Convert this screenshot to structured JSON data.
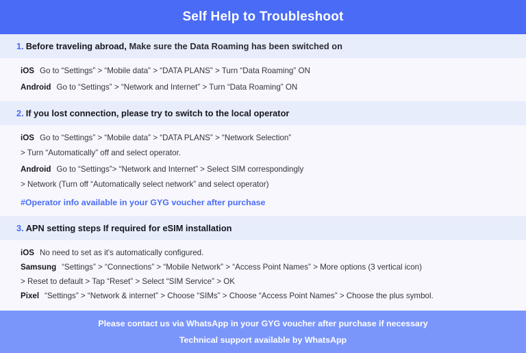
{
  "header": {
    "title": "Self Help to Troubleshoot",
    "bg_color": "#4a6bf5",
    "text_color": "#ffffff"
  },
  "theme": {
    "page_bg": "#f5f5fd",
    "band_bg": "#e7edfb",
    "accent": "#4a6bf5",
    "footer_bg": "#7b96fb",
    "body_text": "#34343e"
  },
  "sections": [
    {
      "number": "1.",
      "lead": "Before traveling abroad,",
      "rest": " Make sure the Data Roaming has been switched on",
      "lines": [
        {
          "label": "iOS",
          "text": "Go to “Settings” > “Mobile data” > “DATA PLANS” > Turn “Data Roaming” ON"
        },
        {
          "label": "Android",
          "text": "Go to “Settings” > “Network and Internet” > Turn “Data Roaming” ON"
        }
      ],
      "note": ""
    },
    {
      "number": "2.",
      "lead": "If you lost connection, please try to switch to the local operator",
      "rest": "",
      "lines": [
        {
          "label": "iOS",
          "text": "Go to “Settings” > “Mobile data” > “DATA PLANS” > “Network Selection”"
        },
        {
          "label": "",
          "text": "> Turn “Automatically” off and select operator."
        },
        {
          "label": "Android",
          "text": "Go to “Settings”>  “Network and Internet” > Select SIM correspondingly"
        },
        {
          "label": "",
          "text": "> Network (Turn off “Automatically select network” and select operator)"
        }
      ],
      "note": "#Operator info available in your GYG voucher after purchase"
    },
    {
      "number": "3.",
      "lead": "APN setting steps If required for eSIM installation",
      "rest": "",
      "lines": [
        {
          "label": "iOS",
          "text": "No need to set as it's automatically configured."
        },
        {
          "label": "Samsung",
          "text": "“Settings” > “Connections” > “Mobile Network” > “Access Point Names” > More options (3 vertical icon)"
        },
        {
          "label": "",
          "text": "> Reset to default > Tap “Reset” > Select “SIM Service” > OK"
        },
        {
          "label": "Pixel",
          "text": "“Settings” > “Network & internet” > Choose “SIMs” > Choose “Access Point Names” > Choose the plus symbol."
        }
      ],
      "note": ""
    }
  ],
  "footer": {
    "line1": "Please contact us via WhatsApp  in your GYG voucher after purchase if necessary",
    "line2": "Technical support available by WhatsApp"
  }
}
